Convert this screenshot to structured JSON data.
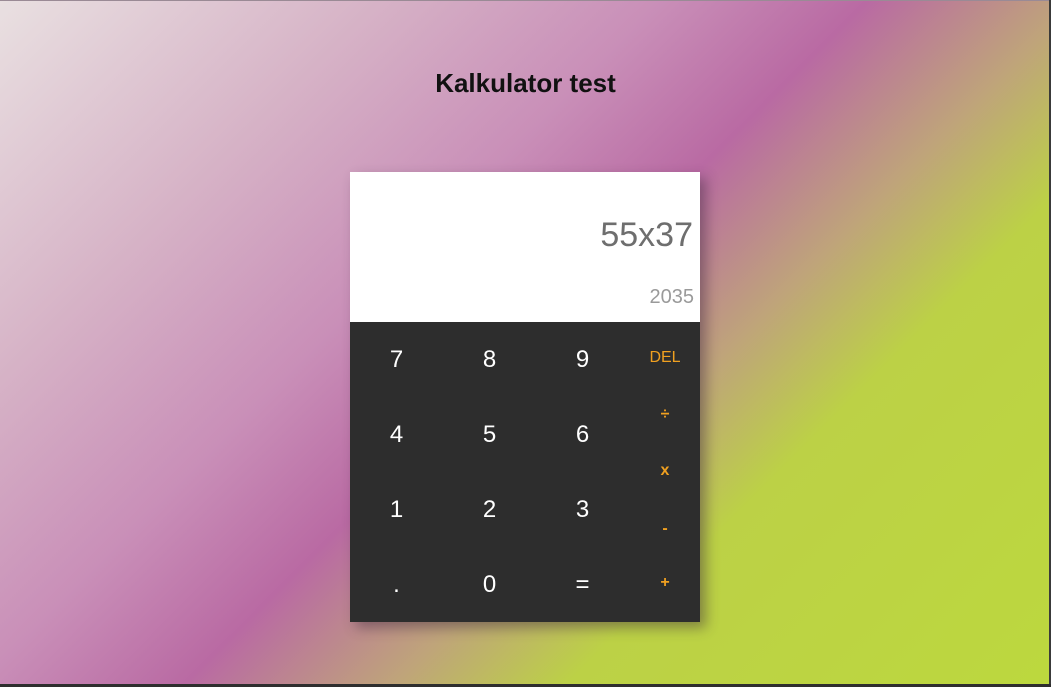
{
  "page": {
    "title": "Kalkulator test"
  },
  "display": {
    "expression": "55x37",
    "result": "2035"
  },
  "keypad": {
    "digits": {
      "seven": "7",
      "eight": "8",
      "nine": "9",
      "four": "4",
      "five": "5",
      "six": "6",
      "one": "1",
      "two": "2",
      "three": "3",
      "decimal": ".",
      "zero": "0",
      "equals": "="
    },
    "operators": {
      "delete": "DEL",
      "divide": "÷",
      "multiply": "x",
      "subtract": "-",
      "add": "+"
    }
  },
  "colors": {
    "keypad_background": "#2d2d2d",
    "operator_accent": "#f0a020",
    "display_background": "#ffffff"
  }
}
